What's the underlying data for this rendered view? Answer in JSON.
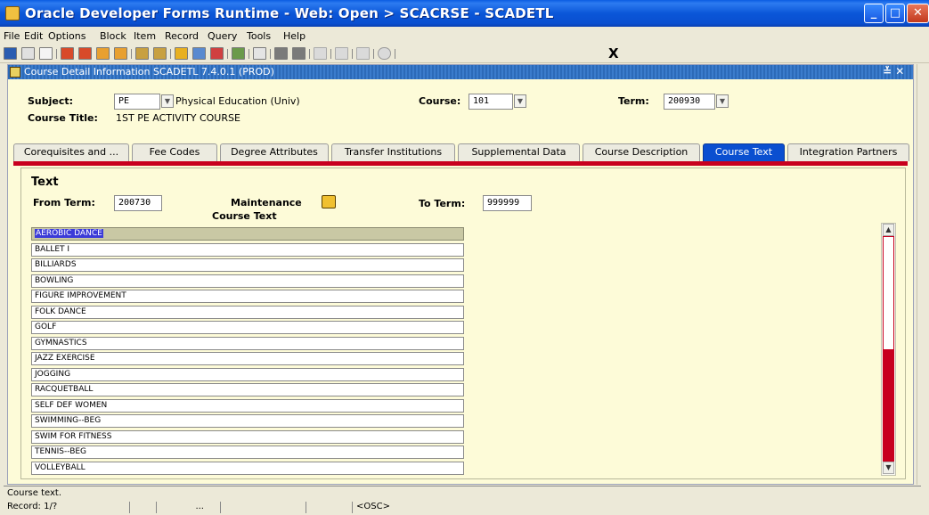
{
  "window": {
    "title": "Oracle Developer Forms Runtime - Web:  Open > SCACRSE - SCADETL"
  },
  "menu": [
    "File",
    "Edit",
    "Options",
    "Block",
    "Item",
    "Record",
    "Query",
    "Tools",
    "Help"
  ],
  "toolbar": {
    "exit_label": "X"
  },
  "form": {
    "title": "Course Detail Information  SCADETL  7.4.0.1  (PROD)",
    "window_controls": "≚ ✕",
    "subject_label": "Subject:",
    "subject_value": "PE",
    "subject_desc": "Physical Education (Univ)",
    "course_label": "Course:",
    "course_value": "101",
    "term_label": "Term:",
    "term_value": "200930",
    "course_title_label": "Course Title:",
    "course_title_value": "1ST PE ACTIVITY COURSE"
  },
  "tabs": [
    {
      "label": "Corequisites and ...",
      "active": false
    },
    {
      "label": "Fee Codes",
      "active": false
    },
    {
      "label": "Degree Attributes",
      "active": false
    },
    {
      "label": "Transfer Institutions",
      "active": false
    },
    {
      "label": "Supplemental Data",
      "active": false
    },
    {
      "label": "Course Description",
      "active": false
    },
    {
      "label": "Course Text",
      "active": true
    },
    {
      "label": "Integration Partners",
      "active": false
    }
  ],
  "text_section": {
    "heading": "Text",
    "from_term_label": "From Term:",
    "from_term_value": "200730",
    "maintenance_label": "Maintenance",
    "course_text_label": "Course Text",
    "to_term_label": "To Term:",
    "to_term_value": "999999"
  },
  "course_text_rows": [
    "AEROBIC DANCE",
    "BALLET I",
    "BILLIARDS",
    "BOWLING",
    "FIGURE IMPROVEMENT",
    "FOLK DANCE",
    "GOLF",
    "GYMNASTICS",
    "JAZZ EXERCISE",
    "JOGGING",
    "RACQUETBALL",
    "SELF DEF WOMEN",
    "SWIMMING--BEG",
    "SWIM FOR FITNESS",
    "TENNIS--BEG",
    "VOLLEYBALL"
  ],
  "selected_row": 0,
  "status": {
    "message": "Course text.",
    "record": "Record: 1/?",
    "segment3": "...",
    "osc": "<OSC>"
  }
}
